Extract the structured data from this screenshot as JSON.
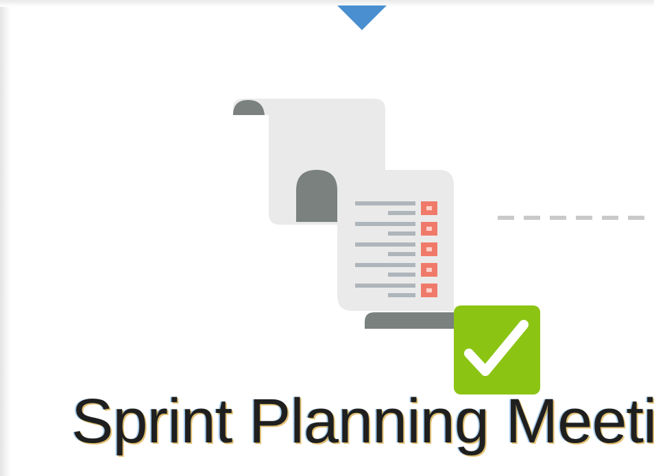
{
  "node": {
    "label": "Sprint Planning Meeting",
    "icon": "document-checklist-icon",
    "status_icon": "checkmark-icon",
    "status": "complete"
  },
  "colors": {
    "arrow": "#4a8fd0",
    "paper": "#eaeaea",
    "paper_dark": "#7a817f",
    "checkbox": "#f07a6a",
    "check_badge": "#8cc414",
    "connector": "#c9c9c9"
  }
}
